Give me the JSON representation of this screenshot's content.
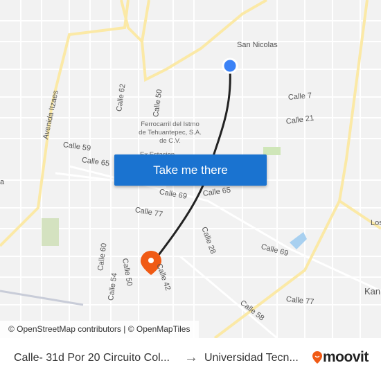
{
  "map": {
    "labels": {
      "san_nicolas": "San Nicolas",
      "calle_7": "Calle 7",
      "calle_21": "Calle 21",
      "calle_59": "Calle 59",
      "calle_65_west": "Calle 65",
      "calle_62": "Calle 62",
      "calle_50_north": "Calle 50",
      "avenida_itzaes": "Avenida Itzaes",
      "ferrocarril": "Ferrocarril del Istmo de Tehuantepec, S.A. de C.V.",
      "ex_estacion": "Ex Estacion",
      "calle_69_center": "Calle 69",
      "calle_65_center": "Calle 65",
      "calle_77_west": "Calle 77",
      "calle_28": "Calle 28",
      "calle_69_east": "Calle 69",
      "calle_60": "Calle 60",
      "calle_54": "Calle 54",
      "calle_50_south": "Calle 50",
      "calle_42": "Calle 42",
      "calle_58": "Calle 58",
      "calle_77_east": "Calle 77",
      "kan": "Kan",
      "los": "Los",
      "a": "a"
    },
    "origin_color": "#3b82f6",
    "destination_color": "#f05a14",
    "route_color": "#222222",
    "road_color": "#fbe9a6"
  },
  "cta": {
    "label": "Take me there",
    "color": "#1a73d0"
  },
  "attribution": "© OpenStreetMap contributors | © OpenMapTiles",
  "footer": {
    "from": "Calle- 31d Por 20 Circuito Col...",
    "arrow": "→",
    "to": "Universidad Tecn...",
    "logo": "moovit",
    "logo_color": "#f05a14"
  }
}
